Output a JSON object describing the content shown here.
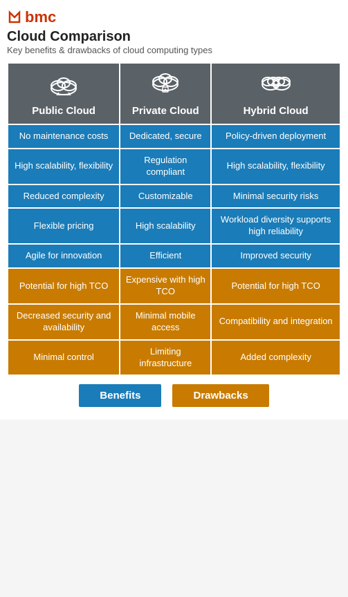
{
  "logo": {
    "text": "bmc"
  },
  "title": "Cloud Comparison",
  "subtitle": "Key benefits & drawbacks of cloud computing types",
  "columns": [
    {
      "id": "public",
      "label": "Public Cloud",
      "icon": "☁"
    },
    {
      "id": "private",
      "label": "Private Cloud",
      "icon": "🔒"
    },
    {
      "id": "hybrid",
      "label": "Hybrid Cloud",
      "icon": "☁"
    }
  ],
  "rows": [
    {
      "type": "benefit",
      "cells": [
        "No maintenance costs",
        "Dedicated, secure",
        "Policy-driven deployment"
      ]
    },
    {
      "type": "benefit",
      "cells": [
        "High scalability, flexibility",
        "Regulation compliant",
        "High scalability, flexibility"
      ]
    },
    {
      "type": "benefit",
      "cells": [
        "Reduced complexity",
        "Customizable",
        "Minimal security risks"
      ]
    },
    {
      "type": "benefit",
      "cells": [
        "Flexible pricing",
        "High scalability",
        "Workload diversity supports high reliability"
      ]
    },
    {
      "type": "benefit",
      "cells": [
        "Agile for innovation",
        "Efficient",
        "Improved security"
      ]
    },
    {
      "type": "drawback",
      "cells": [
        "Potential for high TCO",
        "Expensive with high TCO",
        "Potential for high TCO"
      ]
    },
    {
      "type": "drawback",
      "cells": [
        "Decreased security and availability",
        "Minimal mobile access",
        "Compatibility and integration"
      ]
    },
    {
      "type": "drawback",
      "cells": [
        "Minimal control",
        "Limiting infrastructure",
        "Added complexity"
      ]
    }
  ],
  "legend": {
    "benefits_label": "Benefits",
    "drawbacks_label": "Drawbacks"
  }
}
